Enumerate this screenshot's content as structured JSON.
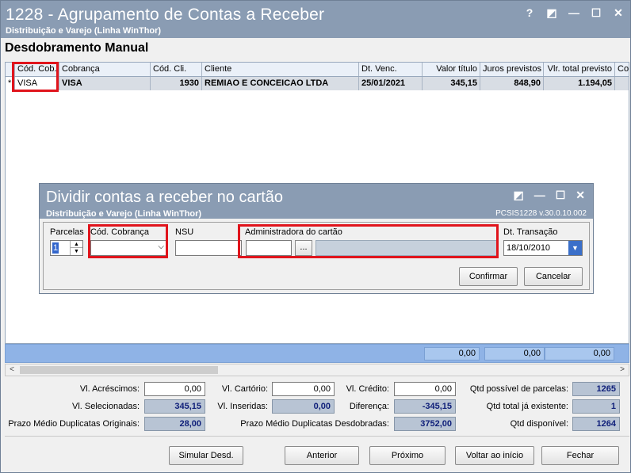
{
  "window": {
    "title": "1228 - Agrupamento de Contas a Receber",
    "subtitle": "Distribuição e Varejo (Linha WinThor)",
    "buttons": [
      "?",
      "◩",
      "—",
      "☐",
      "✕"
    ]
  },
  "section_title": "Desdobramento Manual",
  "grid": {
    "columns": [
      "Cód. Cob.",
      "Cobrança",
      "Cód. Cli.",
      "Cliente",
      "Dt. Venc.",
      "Valor título",
      "Juros previstos",
      "Vlr. total previsto",
      "Cor"
    ],
    "row": {
      "marker": "*",
      "cod_cob": "VISA",
      "cobranca": "VISA",
      "cod_cli": "1930",
      "cliente": "REMIAO E CONCEICAO LTDA",
      "dt_venc": "25/01/2021",
      "valor_titulo": "345,15",
      "juros": "848,90",
      "vlr_total": "1.194,05"
    },
    "totals": [
      "0,00",
      "0,00",
      "0,00"
    ]
  },
  "dialog": {
    "title": "Dividir contas a receber no cartão",
    "subtitle": "Distribuição e Varejo (Linha WinThor)",
    "version": "PCSIS1228  v.30.0.10.002",
    "fields": {
      "parcelas_label": "Parcelas",
      "parcelas_value": "1",
      "cod_cobranca_label": "Cód. Cobrança",
      "cod_cobranca_value": "",
      "nsu_label": "NSU",
      "nsu_value": "",
      "admin_label": "Administradora do cartão",
      "admin_code": "",
      "admin_browse": "...",
      "admin_name": "",
      "dt_transacao_label": "Dt. Transação",
      "dt_transacao_value": "18/10/2010"
    },
    "buttons": {
      "confirm": "Confirmar",
      "cancel": "Cancelar"
    }
  },
  "summary": {
    "acrescimos_label": "Vl. Acréscimos:",
    "acrescimos": "0,00",
    "cartorio_label": "Vl. Cartório:",
    "cartorio": "0,00",
    "credito_label": "Vl. Crédito:",
    "credito": "0,00",
    "qtd_possivel_label": "Qtd possível de parcelas:",
    "qtd_possivel": "1265",
    "selecionadas_label": "Vl. Selecionadas:",
    "selecionadas": "345,15",
    "inseridas_label": "Vl. Inseridas:",
    "inseridas": "0,00",
    "diferenca_label": "Diferença:",
    "diferenca": "-345,15",
    "qtd_existente_label": "Qtd total já existente:",
    "qtd_existente": "1",
    "prazo_orig_label": "Prazo Médio Duplicatas Originais:",
    "prazo_orig": "28,00",
    "prazo_desd_label": "Prazo Médio Duplicatas Desdobradas:",
    "prazo_desd": "3752,00",
    "qtd_disponivel_label": "Qtd disponível:",
    "qtd_disponivel": "1264"
  },
  "footer_buttons": {
    "simular": "Simular Desd.",
    "anterior": "Anterior",
    "proximo": "Próximo",
    "voltar": "Voltar ao início",
    "fechar": "Fechar"
  },
  "colors": {
    "titlebar": "#8a9cb3",
    "highlight": "#e0141c",
    "summary_bar": "#8fb3e6"
  }
}
